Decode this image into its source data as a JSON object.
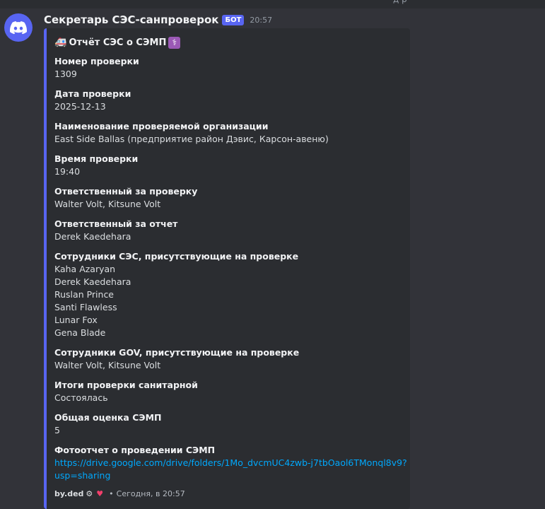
{
  "top_fragment": "д р",
  "message": {
    "author": "Секретарь СЭС-санпроверок",
    "bot_tag": "БОТ",
    "time": "20:57"
  },
  "embed": {
    "accent_color": "#5865f2",
    "title": "Отчёт СЭС о СЭМП",
    "title_icons": [
      "ambulance-icon",
      "medical-symbol-icon"
    ],
    "fields": [
      {
        "name": "Номер проверки",
        "lines": [
          "1309"
        ]
      },
      {
        "name": "Дата проверки",
        "lines": [
          "2025-12-13"
        ]
      },
      {
        "name": "Наименование проверяемой организации",
        "lines": [
          "East Side Ballas (предприятие район Дэвис, Карсон-авеню)"
        ]
      },
      {
        "name": "Время проверки",
        "lines": [
          "19:40"
        ]
      },
      {
        "name": "Ответственный за проверку",
        "lines": [
          "Walter Volt, Kitsune Volt"
        ]
      },
      {
        "name": "Ответственный за отчет",
        "lines": [
          "Derek Kaedehara"
        ]
      },
      {
        "name": "Сотрудники СЭС, присутствующие на проверке",
        "lines": [
          "Kaha Azaryan",
          "Derek Kaedehara",
          "Ruslan Prince",
          "Santi Flawless",
          "Lunar Fox",
          "Gena Blade"
        ]
      },
      {
        "name": "Сотрудники GOV, присутствующие на проверке",
        "lines": [
          "Walter Volt, Kitsune Volt"
        ]
      },
      {
        "name": "Итоги проверки санитарной",
        "lines": [
          "Состоялась"
        ]
      },
      {
        "name": "Общая оценка СЭМП",
        "lines": [
          "5"
        ]
      }
    ],
    "link_field": {
      "name": "Фотоотчет о проведении СЭМП",
      "url_lines": [
        "https://drive.google.com/drive/folders/1Mo_dvcmUC4zwb-j7tbOaol6TMonql8v9?",
        "usp=sharing"
      ]
    },
    "footer": {
      "author": "by.ded",
      "separator": "•",
      "time_text": "Сегодня, в 20:57"
    }
  }
}
